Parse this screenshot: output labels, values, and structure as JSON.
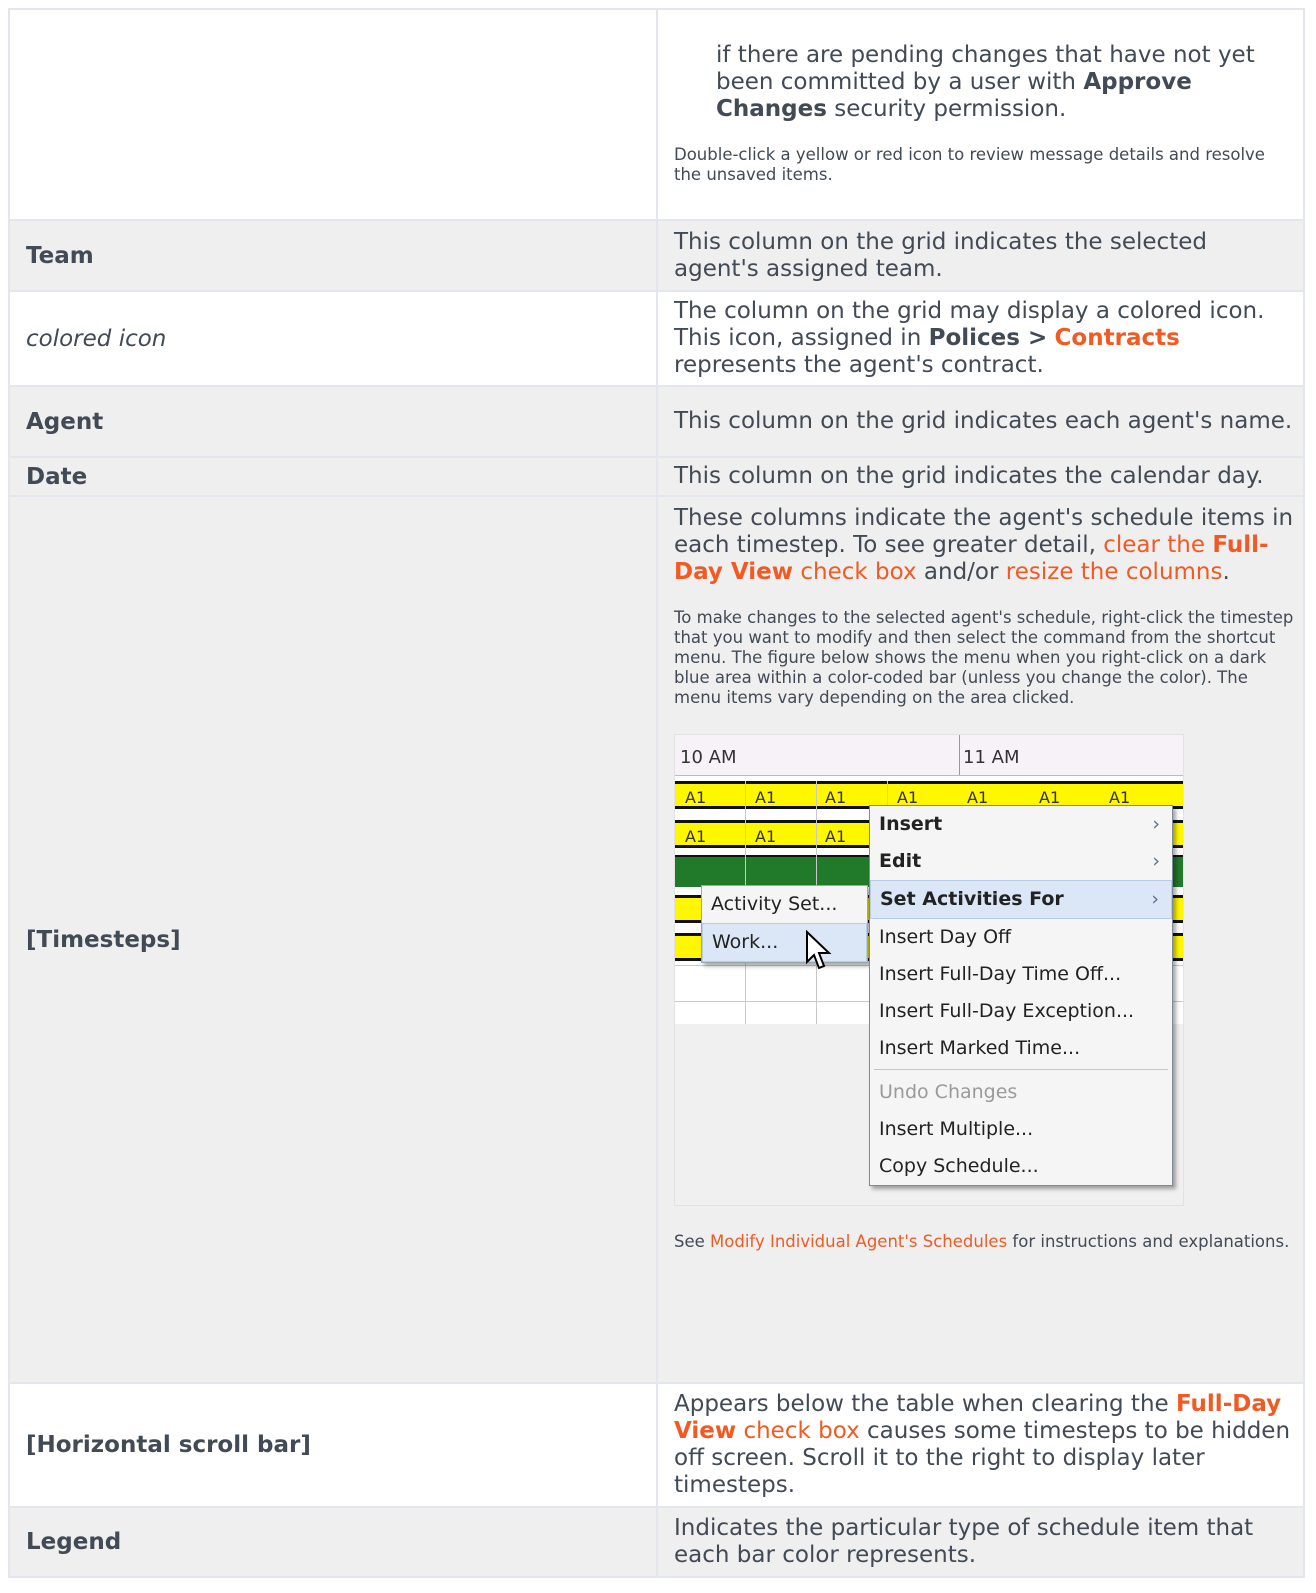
{
  "top_row": {
    "indent_text_1": "if there are pending changes that have not yet been committed by a user with ",
    "indent_bold": "Approve Changes",
    "indent_text_2": " security permission.",
    "note": "Double-click a yellow or red icon to review message details and resolve the unsaved items."
  },
  "rows": {
    "team": {
      "label": "Team",
      "desc": "This column on the grid indicates the selected agent's assigned team."
    },
    "colored_icon": {
      "label": "colored icon",
      "desc_1": "The column on the grid may display a colored icon. This icon, assigned in ",
      "desc_bold": "Polices >",
      "desc_link": "Contracts",
      "desc_2": " represents the agent's contract."
    },
    "agent": {
      "label": "Agent",
      "desc": "This column on the grid indicates each agent's name."
    },
    "date": {
      "label": "Date",
      "desc": "This column on the grid indicates the calendar day."
    },
    "timesteps": {
      "label": "[Timesteps]",
      "p1_a": "These columns indicate the agent's schedule items in each timestep. To see greater detail, ",
      "p1_link1": "clear the ",
      "p1_link1_bold": "Full-Day View",
      "p1_link1_end": " check box",
      "p1_b": " and/or ",
      "p1_link2": "resize the columns",
      "p1_c": ".",
      "p2": "To make changes to the selected agent's schedule, right-click the timestep that you want to modify and then select the command from the shortcut menu. The figure below shows the menu when you right-click on a dark blue area within a color-coded bar (unless you change the color).  The menu items vary depending on the area clicked.",
      "p3_a": "See ",
      "p3_link": "Modify Individual Agent's Schedules",
      "p3_b": " for instructions and explanations."
    },
    "hscroll": {
      "label": "[Horizontal scroll bar]",
      "desc_1": "Appears below the table when clearing the ",
      "desc_link_bold": "Full-Day View",
      "desc_link": " check box",
      "desc_2": " causes some timesteps to be hidden off screen. Scroll it to the right to display later timesteps."
    },
    "legend": {
      "label": "Legend",
      "desc": "Indicates the particular type of schedule item that each bar color represents."
    }
  },
  "screenshot": {
    "time_1": "10 AM",
    "time_2": "11 AM",
    "bar_label": "A1",
    "main_menu": [
      {
        "label": "Insert",
        "bold": true,
        "arrow": "›"
      },
      {
        "label": "Edit",
        "bold": true,
        "arrow": "›"
      },
      {
        "label": "Set Activities For",
        "bold": true,
        "arrow": "›",
        "highlight": true
      },
      {
        "label": "Insert Day Off"
      },
      {
        "label": "Insert Full-Day Time Off..."
      },
      {
        "label": "Insert Full-Day Exception..."
      },
      {
        "label": "Insert Marked Time..."
      },
      {
        "label": "Undo Changes",
        "disabled": true
      },
      {
        "label": "Insert Multiple..."
      },
      {
        "label": "Copy Schedule..."
      }
    ],
    "sub_menu": [
      {
        "label": "Activity Set..."
      },
      {
        "label": "Work...",
        "highlight": true
      }
    ]
  },
  "colors": {
    "link": "#f15a22",
    "text": "#414a55",
    "shade": "#efefef",
    "bar_yellow": "#fff700",
    "bar_green": "#217a2a"
  }
}
